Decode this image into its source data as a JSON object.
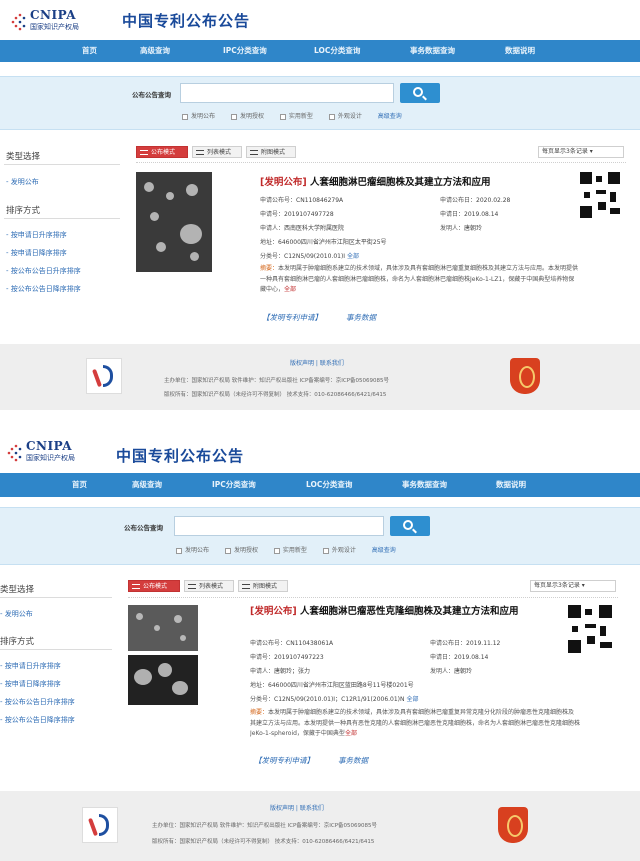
{
  "header": {
    "brand": "CNIPA",
    "org": "国家知识产权局",
    "title": "中国专利公布公告"
  },
  "nav": [
    "首页",
    "高级查询",
    "IPC分类查询",
    "LOC分类查询",
    "事务数据查询",
    "数据说明"
  ],
  "search": {
    "label": "公布公告查询",
    "value": "",
    "filters": [
      "发明公布",
      "发明授权",
      "实用新型",
      "外观设计"
    ],
    "advanced": "高级查询"
  },
  "sidebar": {
    "type_heading": "类型选择",
    "type_link": "- 发明公布",
    "sort_heading": "排序方式",
    "sort_links": [
      "- 按申请日升序排序",
      "- 按申请日降序排序",
      "- 按公布公告日升序排序",
      "- 按公布公告日降序排序"
    ]
  },
  "view": {
    "tabs": [
      "公布模式",
      "列表模式",
      "附图模式"
    ],
    "per_page": "每页显示3条记录"
  },
  "records": [
    {
      "kind": "[发明公布]",
      "title": "人套细胞淋巴瘤细胞株及其建立方法和应用",
      "pub_no_label": "申请公布号：",
      "pub_no": "CN110846279A",
      "pub_date_label": "申请公布日：",
      "pub_date": "2020.02.28",
      "app_no_label": "申请号：",
      "app_no": "2019107497728",
      "app_date_label": "申请日：",
      "app_date": "2019.08.14",
      "applicant_label": "申请人：",
      "applicant": "西南医科大学附属医院",
      "inventor_label": "发明人：",
      "inventor": "唐朝玲",
      "address_label": "地址：",
      "address": "646000四川省泸州市江阳区太平街25号",
      "class_label": "分类号：",
      "class": "C12N5/09(2010.01)I",
      "abstract_label": "摘要：",
      "abstract": "本发明属于肿瘤细胞系建立的技术领域，具体涉及具有套细胞淋巴瘤重复细胞株及其建立方法与应用。本发明提供一种具有套细胞淋巴瘤的人套细胞淋巴瘤细胞株，命名为人套细胞淋巴瘤细胞株JeKo-1-LZ1，保藏于中国典型培养物保藏中心，",
      "all": "全部",
      "link_1": "【发明专利申请】",
      "link_2": "事务数据"
    },
    {
      "kind": "[发明公布]",
      "title": "人套细胞淋巴瘤恶性克隆细胞株及其建立方法和应用",
      "pub_no_label": "申请公布号：",
      "pub_no": "CN110438061A",
      "pub_date_label": "申请公布日：",
      "pub_date": "2019.11.12",
      "app_no_label": "申请号：",
      "app_no": "2019107497223",
      "app_date_label": "申请日：",
      "app_date": "2019.08.14",
      "applicant_label": "申请人：",
      "applicant": "唐朝玲；张力",
      "inventor_label": "发明人：",
      "inventor": "唐朝玲",
      "address_label": "地址：",
      "address": "646000四川省泸州市江阳区蓝田路8号11号楼0201号",
      "class_label": "分类号：",
      "class": "C12N5/09(2010.01)I；C12R1/91(2006.01)N",
      "abstract_label": "摘要：",
      "abstract": "本发明属于肿瘤细胞系建立的技术领域，具体涉及具有套细胞淋巴瘤重复异常克隆分化阶段的肿瘤恶性克隆细胞株及其建立方法与应用。本发明提供一种具有恶性克隆的人套细胞淋巴瘤恶性克隆细胞株，命名为人套细胞淋巴瘤恶性克隆细胞株JeKo-1-spheroid，保藏于中国典型",
      "all": "全部",
      "link_1": "【发明专利申请】",
      "link_2": "事务数据"
    }
  ],
  "footer": {
    "links": "版权声明 | 联系我们",
    "line1": "主办单位：国家知识产权局    软件维护：知识产权出版社    ICP备案编号：京ICP备05069085号",
    "line2": "版权所有：国家知识产权局（未经许可不得复制）    技术支持：010-62086466/6421/6415"
  }
}
